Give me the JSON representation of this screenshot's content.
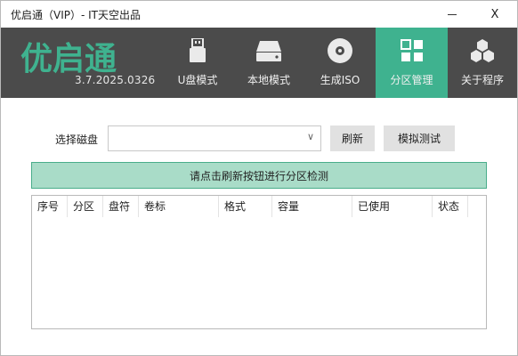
{
  "window": {
    "title": "优启通（VIP）- IT天空出品",
    "close_glyph": "X"
  },
  "header": {
    "logo_text": "优启通",
    "version": "3.7.2025.0326",
    "tabs": [
      {
        "label": "U盘模式",
        "icon": "usb-drive-icon",
        "active": false
      },
      {
        "label": "本地模式",
        "icon": "hard-disk-icon",
        "active": false
      },
      {
        "label": "生成ISO",
        "icon": "disc-icon",
        "active": false
      },
      {
        "label": "分区管理",
        "icon": "grid-icon",
        "active": true
      },
      {
        "label": "关于程序",
        "icon": "hexagons-icon",
        "active": false
      }
    ],
    "background_color": "#4b4b4b",
    "accent_color": "#3fb28f"
  },
  "main": {
    "disk_label": "选择磁盘",
    "disk_select_value": "",
    "disk_select_chevron": "∨",
    "refresh_label": "刷新",
    "simulate_label": "模拟测试",
    "status_message": "请点击刷新按钮进行分区检测",
    "status_bg_color": "#a9dcc8",
    "table": {
      "columns": [
        "序号",
        "分区",
        "盘符",
        "卷标",
        "格式",
        "容量",
        "已使用",
        "状态"
      ],
      "rows": []
    }
  }
}
